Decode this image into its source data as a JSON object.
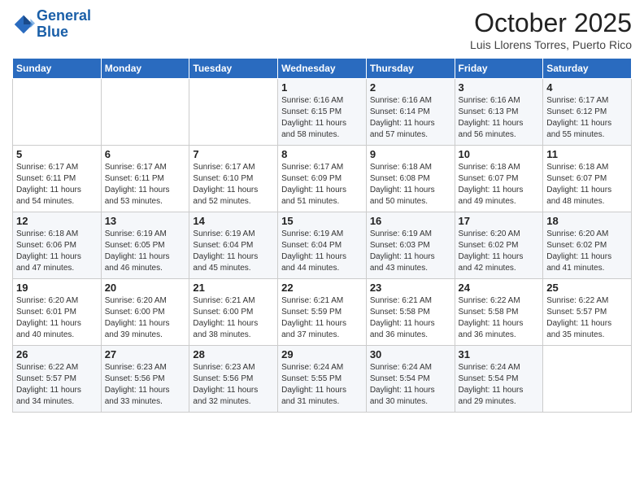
{
  "header": {
    "logo_line1": "General",
    "logo_line2": "Blue",
    "month": "October 2025",
    "location": "Luis Llorens Torres, Puerto Rico"
  },
  "weekdays": [
    "Sunday",
    "Monday",
    "Tuesday",
    "Wednesday",
    "Thursday",
    "Friday",
    "Saturday"
  ],
  "weeks": [
    [
      {
        "day": "",
        "info": ""
      },
      {
        "day": "",
        "info": ""
      },
      {
        "day": "",
        "info": ""
      },
      {
        "day": "1",
        "info": "Sunrise: 6:16 AM\nSunset: 6:15 PM\nDaylight: 11 hours\nand 58 minutes."
      },
      {
        "day": "2",
        "info": "Sunrise: 6:16 AM\nSunset: 6:14 PM\nDaylight: 11 hours\nand 57 minutes."
      },
      {
        "day": "3",
        "info": "Sunrise: 6:16 AM\nSunset: 6:13 PM\nDaylight: 11 hours\nand 56 minutes."
      },
      {
        "day": "4",
        "info": "Sunrise: 6:17 AM\nSunset: 6:12 PM\nDaylight: 11 hours\nand 55 minutes."
      }
    ],
    [
      {
        "day": "5",
        "info": "Sunrise: 6:17 AM\nSunset: 6:11 PM\nDaylight: 11 hours\nand 54 minutes."
      },
      {
        "day": "6",
        "info": "Sunrise: 6:17 AM\nSunset: 6:11 PM\nDaylight: 11 hours\nand 53 minutes."
      },
      {
        "day": "7",
        "info": "Sunrise: 6:17 AM\nSunset: 6:10 PM\nDaylight: 11 hours\nand 52 minutes."
      },
      {
        "day": "8",
        "info": "Sunrise: 6:17 AM\nSunset: 6:09 PM\nDaylight: 11 hours\nand 51 minutes."
      },
      {
        "day": "9",
        "info": "Sunrise: 6:18 AM\nSunset: 6:08 PM\nDaylight: 11 hours\nand 50 minutes."
      },
      {
        "day": "10",
        "info": "Sunrise: 6:18 AM\nSunset: 6:07 PM\nDaylight: 11 hours\nand 49 minutes."
      },
      {
        "day": "11",
        "info": "Sunrise: 6:18 AM\nSunset: 6:07 PM\nDaylight: 11 hours\nand 48 minutes."
      }
    ],
    [
      {
        "day": "12",
        "info": "Sunrise: 6:18 AM\nSunset: 6:06 PM\nDaylight: 11 hours\nand 47 minutes."
      },
      {
        "day": "13",
        "info": "Sunrise: 6:19 AM\nSunset: 6:05 PM\nDaylight: 11 hours\nand 46 minutes."
      },
      {
        "day": "14",
        "info": "Sunrise: 6:19 AM\nSunset: 6:04 PM\nDaylight: 11 hours\nand 45 minutes."
      },
      {
        "day": "15",
        "info": "Sunrise: 6:19 AM\nSunset: 6:04 PM\nDaylight: 11 hours\nand 44 minutes."
      },
      {
        "day": "16",
        "info": "Sunrise: 6:19 AM\nSunset: 6:03 PM\nDaylight: 11 hours\nand 43 minutes."
      },
      {
        "day": "17",
        "info": "Sunrise: 6:20 AM\nSunset: 6:02 PM\nDaylight: 11 hours\nand 42 minutes."
      },
      {
        "day": "18",
        "info": "Sunrise: 6:20 AM\nSunset: 6:02 PM\nDaylight: 11 hours\nand 41 minutes."
      }
    ],
    [
      {
        "day": "19",
        "info": "Sunrise: 6:20 AM\nSunset: 6:01 PM\nDaylight: 11 hours\nand 40 minutes."
      },
      {
        "day": "20",
        "info": "Sunrise: 6:20 AM\nSunset: 6:00 PM\nDaylight: 11 hours\nand 39 minutes."
      },
      {
        "day": "21",
        "info": "Sunrise: 6:21 AM\nSunset: 6:00 PM\nDaylight: 11 hours\nand 38 minutes."
      },
      {
        "day": "22",
        "info": "Sunrise: 6:21 AM\nSunset: 5:59 PM\nDaylight: 11 hours\nand 37 minutes."
      },
      {
        "day": "23",
        "info": "Sunrise: 6:21 AM\nSunset: 5:58 PM\nDaylight: 11 hours\nand 36 minutes."
      },
      {
        "day": "24",
        "info": "Sunrise: 6:22 AM\nSunset: 5:58 PM\nDaylight: 11 hours\nand 36 minutes."
      },
      {
        "day": "25",
        "info": "Sunrise: 6:22 AM\nSunset: 5:57 PM\nDaylight: 11 hours\nand 35 minutes."
      }
    ],
    [
      {
        "day": "26",
        "info": "Sunrise: 6:22 AM\nSunset: 5:57 PM\nDaylight: 11 hours\nand 34 minutes."
      },
      {
        "day": "27",
        "info": "Sunrise: 6:23 AM\nSunset: 5:56 PM\nDaylight: 11 hours\nand 33 minutes."
      },
      {
        "day": "28",
        "info": "Sunrise: 6:23 AM\nSunset: 5:56 PM\nDaylight: 11 hours\nand 32 minutes."
      },
      {
        "day": "29",
        "info": "Sunrise: 6:24 AM\nSunset: 5:55 PM\nDaylight: 11 hours\nand 31 minutes."
      },
      {
        "day": "30",
        "info": "Sunrise: 6:24 AM\nSunset: 5:54 PM\nDaylight: 11 hours\nand 30 minutes."
      },
      {
        "day": "31",
        "info": "Sunrise: 6:24 AM\nSunset: 5:54 PM\nDaylight: 11 hours\nand 29 minutes."
      },
      {
        "day": "",
        "info": ""
      }
    ]
  ]
}
